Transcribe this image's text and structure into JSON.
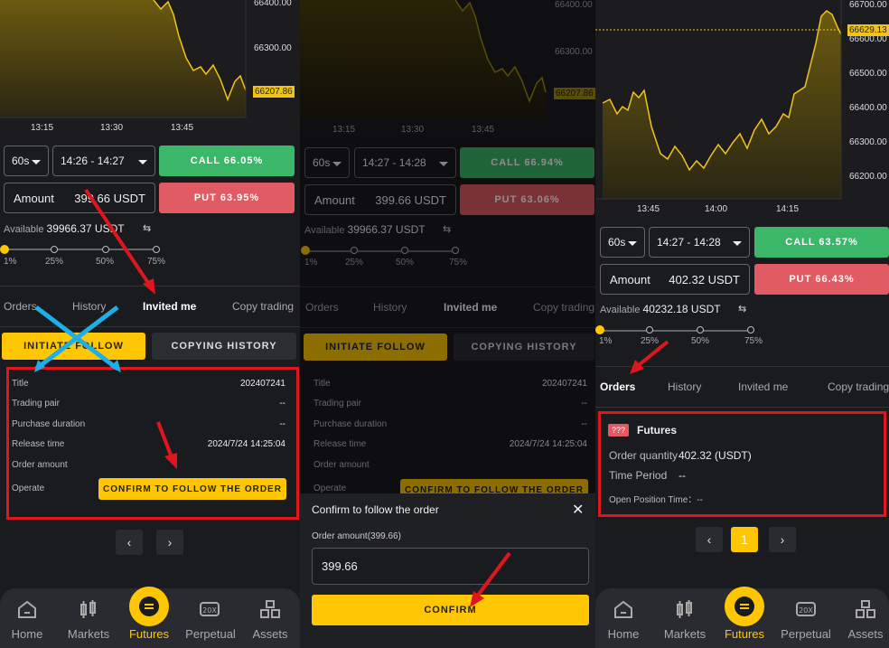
{
  "colors": {
    "call": "#3bb76a",
    "put": "#e05b63",
    "accent": "#ffc703",
    "annotation": "#e0161e",
    "cross": "#1eaee8"
  },
  "panel1": {
    "yticks": [
      "66400.00",
      "66300.00"
    ],
    "price_tag": "66207.86",
    "xticks": [
      "13:15",
      "13:30",
      "13:45"
    ],
    "interval": "60s",
    "time_range": "14:26 - 14:27",
    "call": "CALL 66.05%",
    "put": "PUT 63.95%",
    "amount_label": "Amount",
    "amount_value": "399.66 USDT",
    "available_label": "Available",
    "available_value": "39966.37 USDT",
    "pcts": [
      "1%",
      "25%",
      "50%",
      "75%"
    ],
    "tabs": [
      "Orders",
      "History",
      "Invited me",
      "Copy trading"
    ],
    "initiate": "INITIATE FOLLOW",
    "copying": "COPYING HISTORY",
    "rows": [
      {
        "k": "Title",
        "v": "202407241"
      },
      {
        "k": "Trading pair",
        "v": "--"
      },
      {
        "k": "Purchase duration",
        "v": "--"
      },
      {
        "k": "Release time",
        "v": "2024/7/24 14:25:04"
      },
      {
        "k": "Order amount",
        "v": ""
      },
      {
        "k": "Operate",
        "v": ""
      }
    ],
    "confirm_follow": "CONFIRM TO FOLLOW THE ORDER",
    "nav": [
      "Home",
      "Markets",
      "Futures",
      "Perpetual",
      "Assets"
    ]
  },
  "panel2": {
    "yticks": [
      "66400.00",
      "66300.00"
    ],
    "price_tag": "66207.86",
    "xticks": [
      "13:15",
      "13:30",
      "13:45"
    ],
    "interval": "60s",
    "time_range": "14:27 - 14:28",
    "call": "CALL 66.94%",
    "put": "PUT 63.06%",
    "amount_label": "Amount",
    "amount_value": "399.66 USDT",
    "available_label": "Available",
    "available_value": "39966.37 USDT",
    "pcts": [
      "1%",
      "25%",
      "50%",
      "75%"
    ],
    "tabs": [
      "Orders",
      "History",
      "Invited me",
      "Copy trading"
    ],
    "initiate": "INITIATE FOLLOW",
    "copying": "COPYING HISTORY",
    "rows": [
      {
        "k": "Title",
        "v": "202407241"
      },
      {
        "k": "Trading pair",
        "v": "--"
      },
      {
        "k": "Purchase duration",
        "v": "--"
      },
      {
        "k": "Release time",
        "v": "2024/7/24 14:25:04"
      },
      {
        "k": "Order amount",
        "v": ""
      },
      {
        "k": "Operate",
        "v": ""
      }
    ],
    "confirm_follow": "CONFIRM TO FOLLOW THE ORDER",
    "modal_title": "Confirm to follow the order",
    "modal_close": "✕",
    "order_amount_label": "Order amount(399.66)",
    "order_amount_value": "399.66",
    "confirm": "CONFIRM"
  },
  "panel3": {
    "yticks": [
      "66700.00",
      "66600.00",
      "66500.00",
      "66400.00",
      "66300.00",
      "66200.00"
    ],
    "price_tag": "66629.13",
    "xticks": [
      "13:45",
      "14:00",
      "14:15"
    ],
    "interval": "60s",
    "time_range": "14:27 - 14:28",
    "call": "CALL 63.57%",
    "put": "PUT 66.43%",
    "amount_label": "Amount",
    "amount_value": "402.32 USDT",
    "available_label": "Available",
    "available_value": "40232.18 USDT",
    "pcts": [
      "1%",
      "25%",
      "50%",
      "75%"
    ],
    "tabs": [
      "Orders",
      "History",
      "Invited me",
      "Copy trading"
    ],
    "futures_badge": "???",
    "futures_title": "Futures",
    "order_qty_label": "Order quantity",
    "order_qty_value": "402.32 (USDT)",
    "time_period_label": "Time Period",
    "time_period_value": "--",
    "open_time": "Open Position Time：--",
    "page": "1",
    "nav": [
      "Home",
      "Markets",
      "Futures",
      "Perpetual",
      "Assets"
    ]
  }
}
